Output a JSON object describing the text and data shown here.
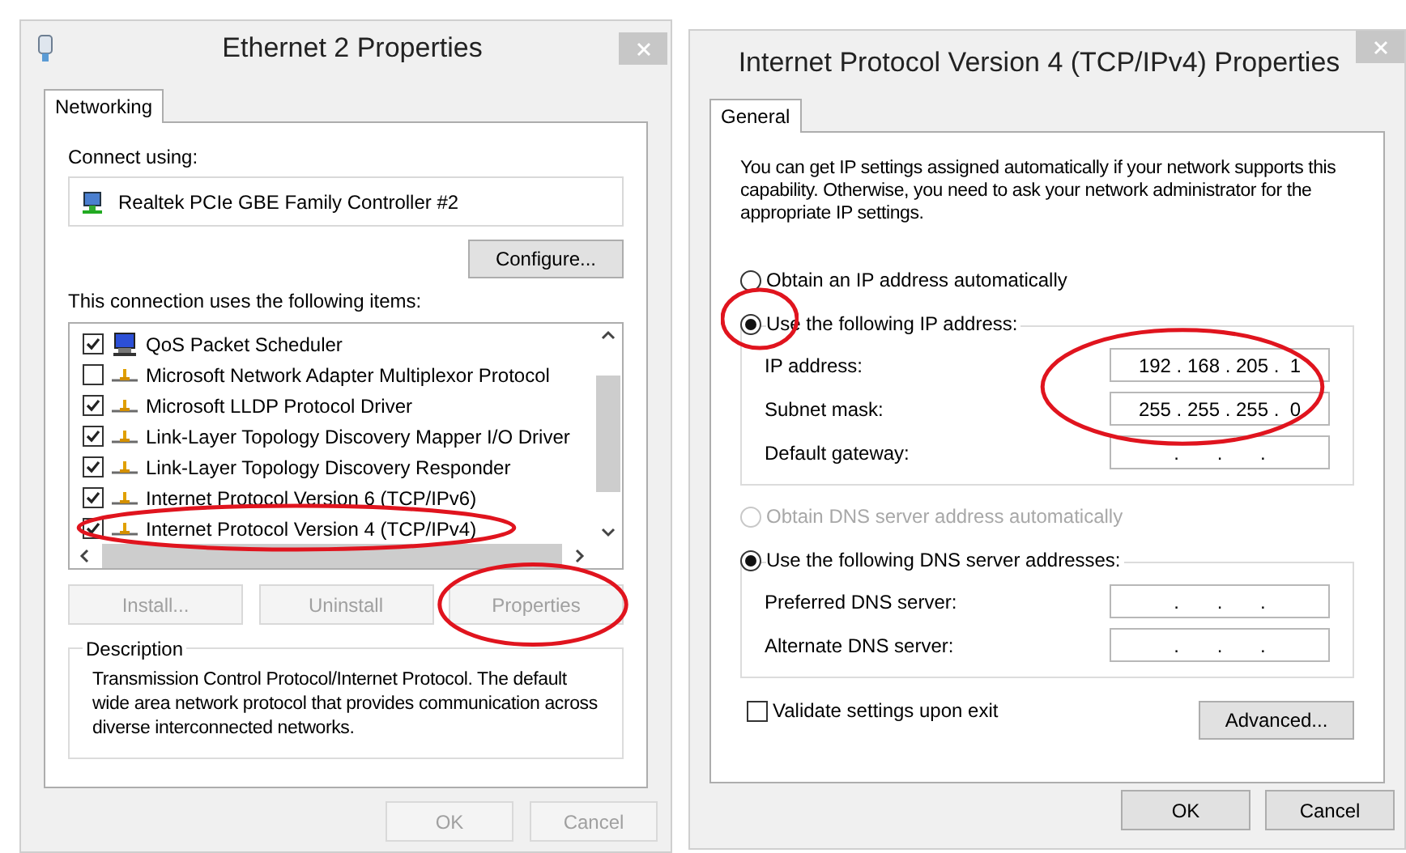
{
  "ethernet_dialog": {
    "title": "Ethernet 2 Properties",
    "tabs": [
      {
        "label": "Networking",
        "selected": true
      }
    ],
    "connect_using_label": "Connect using:",
    "adapter": "Realtek PCIe GBE Family Controller #2",
    "configure_button": "Configure...",
    "items_label": "This connection uses the following items:",
    "items": [
      {
        "kind": "scheduler",
        "label": "QoS Packet Scheduler",
        "checked": true,
        "circled": false
      },
      {
        "kind": "protocol",
        "label": "Microsoft Network Adapter Multiplexor Protocol",
        "checked": false,
        "circled": false
      },
      {
        "kind": "protocol",
        "label": "Microsoft LLDP Protocol Driver",
        "checked": true,
        "circled": false
      },
      {
        "kind": "protocol",
        "label": "Link-Layer Topology Discovery Mapper I/O Driver",
        "checked": true,
        "circled": false
      },
      {
        "kind": "protocol",
        "label": "Link-Layer Topology Discovery Responder",
        "checked": true,
        "circled": false
      },
      {
        "kind": "protocol",
        "label": "Internet Protocol Version 6 (TCP/IPv6)",
        "checked": true,
        "circled": false
      },
      {
        "kind": "protocol",
        "label": "Internet Protocol Version 4 (TCP/IPv4)",
        "checked": true,
        "circled": true
      }
    ],
    "action_buttons": [
      {
        "label": "Install...",
        "disabled": true,
        "circled": false
      },
      {
        "label": "Uninstall",
        "disabled": true,
        "circled": false
      },
      {
        "label": "Properties",
        "disabled": true,
        "circled": true
      }
    ],
    "description_title": "Description",
    "description": "Transmission Control Protocol/Internet Protocol. The default wide area network protocol that provides communication across diverse interconnected networks.",
    "buttons": [
      {
        "label": "OK",
        "disabled": true
      },
      {
        "label": "Cancel",
        "disabled": true
      }
    ]
  },
  "ipv4_dialog": {
    "title": "Internet Protocol Version 4 (TCP/IPv4) Properties",
    "tabs": [
      {
        "label": "General",
        "selected": true
      }
    ],
    "intro": "You can get IP settings assigned automatically if your network supports this capability. Otherwise, you need to ask your network administrator for the appropriate IP settings.",
    "ip_options": [
      {
        "label": "Obtain an IP address automatically",
        "selected": false,
        "disabled": false,
        "circled": false
      },
      {
        "label": "Use the following IP address:",
        "selected": true,
        "disabled": false,
        "circled": true
      }
    ],
    "ip_fields": [
      {
        "label": "IP address:",
        "value": "192 . 168 . 205 .  1",
        "circled": true
      },
      {
        "label": "Subnet mask:",
        "value": "255 . 255 . 255 .  0",
        "circled": true
      },
      {
        "label": "Default gateway:",
        "value": ".       .       .",
        "circled": false
      }
    ],
    "dns_options": [
      {
        "label": "Obtain DNS server address automatically",
        "selected": false,
        "disabled": true,
        "circled": false
      },
      {
        "label": "Use the following DNS server addresses:",
        "selected": true,
        "disabled": false,
        "circled": false
      }
    ],
    "dns_fields": [
      {
        "label": "Preferred DNS server:",
        "value": ".       .       .",
        "circled": false
      },
      {
        "label": "Alternate DNS server:",
        "value": ".       .       .",
        "circled": false
      }
    ],
    "validate": {
      "label": "Validate settings upon exit",
      "checked": false
    },
    "advanced_button": "Advanced...",
    "buttons": [
      {
        "label": "OK",
        "disabled": false
      },
      {
        "label": "Cancel",
        "disabled": false
      }
    ]
  }
}
